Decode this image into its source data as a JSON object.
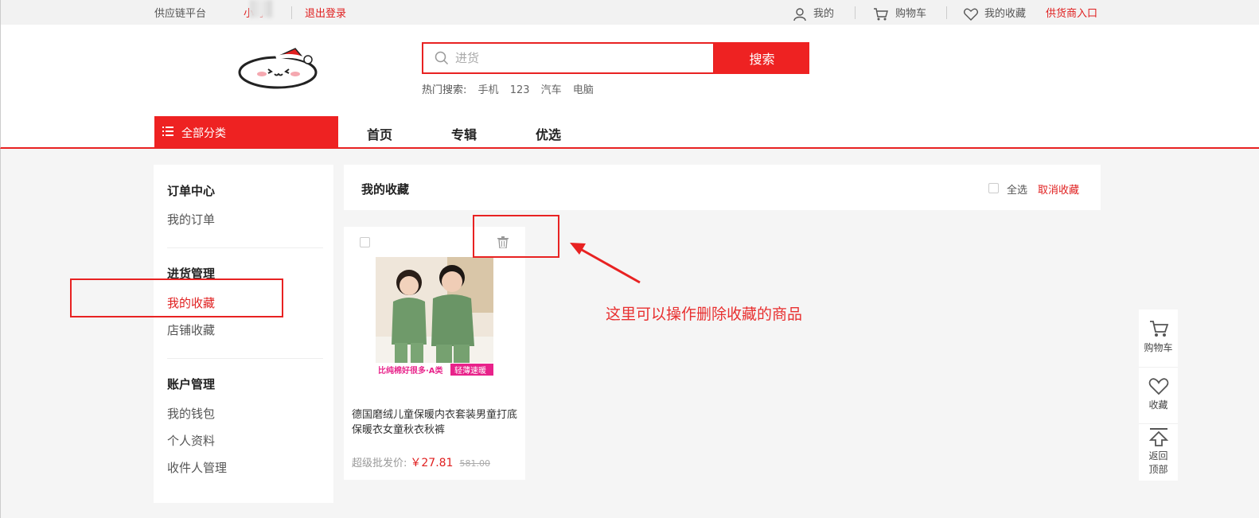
{
  "topbar": {
    "platform": "供应链平台",
    "username": "小 子",
    "logout": "退出登录",
    "mine": "我的",
    "cart": "购物车",
    "favorites": "我的收藏",
    "supplier_entry": "供货商入口"
  },
  "search": {
    "placeholder": "进货",
    "button": "搜索",
    "hot_label": "热门搜索:",
    "hot_keywords": [
      "手机",
      "123",
      "汽车",
      "电脑"
    ]
  },
  "nav": {
    "all_categories": "全部分类",
    "links": [
      "首页",
      "专辑",
      "优选"
    ]
  },
  "sidebar": {
    "groups": [
      {
        "title": "订单中心",
        "items": [
          "我的订单"
        ]
      },
      {
        "title": "进货管理",
        "items": [
          "我的收藏",
          "店铺收藏"
        ]
      },
      {
        "title": "账户管理",
        "items": [
          "我的钱包",
          "个人资料",
          "收件人管理"
        ]
      }
    ],
    "active_item": "我的收藏"
  },
  "main": {
    "title": "我的收藏",
    "select_all": "全选",
    "cancel_favorite": "取消收藏"
  },
  "product": {
    "name": "德国磨绒儿童保暖内衣套装男童打底保暖衣女童秋衣秋裤",
    "price_label": "超级批发价:",
    "price": "￥27.81",
    "original_price": "581.00",
    "image_banner": "比纯棉好很多·A类",
    "image_tag": "轻薄速暖"
  },
  "annotation": {
    "text": "这里可以操作删除收藏的商品"
  },
  "float_bar": {
    "cart": "购物车",
    "favorite": "收藏",
    "back_top_line1": "返回",
    "back_top_line2": "顶部"
  },
  "colors": {
    "accent": "#e82222",
    "text_red": "#e02020"
  }
}
